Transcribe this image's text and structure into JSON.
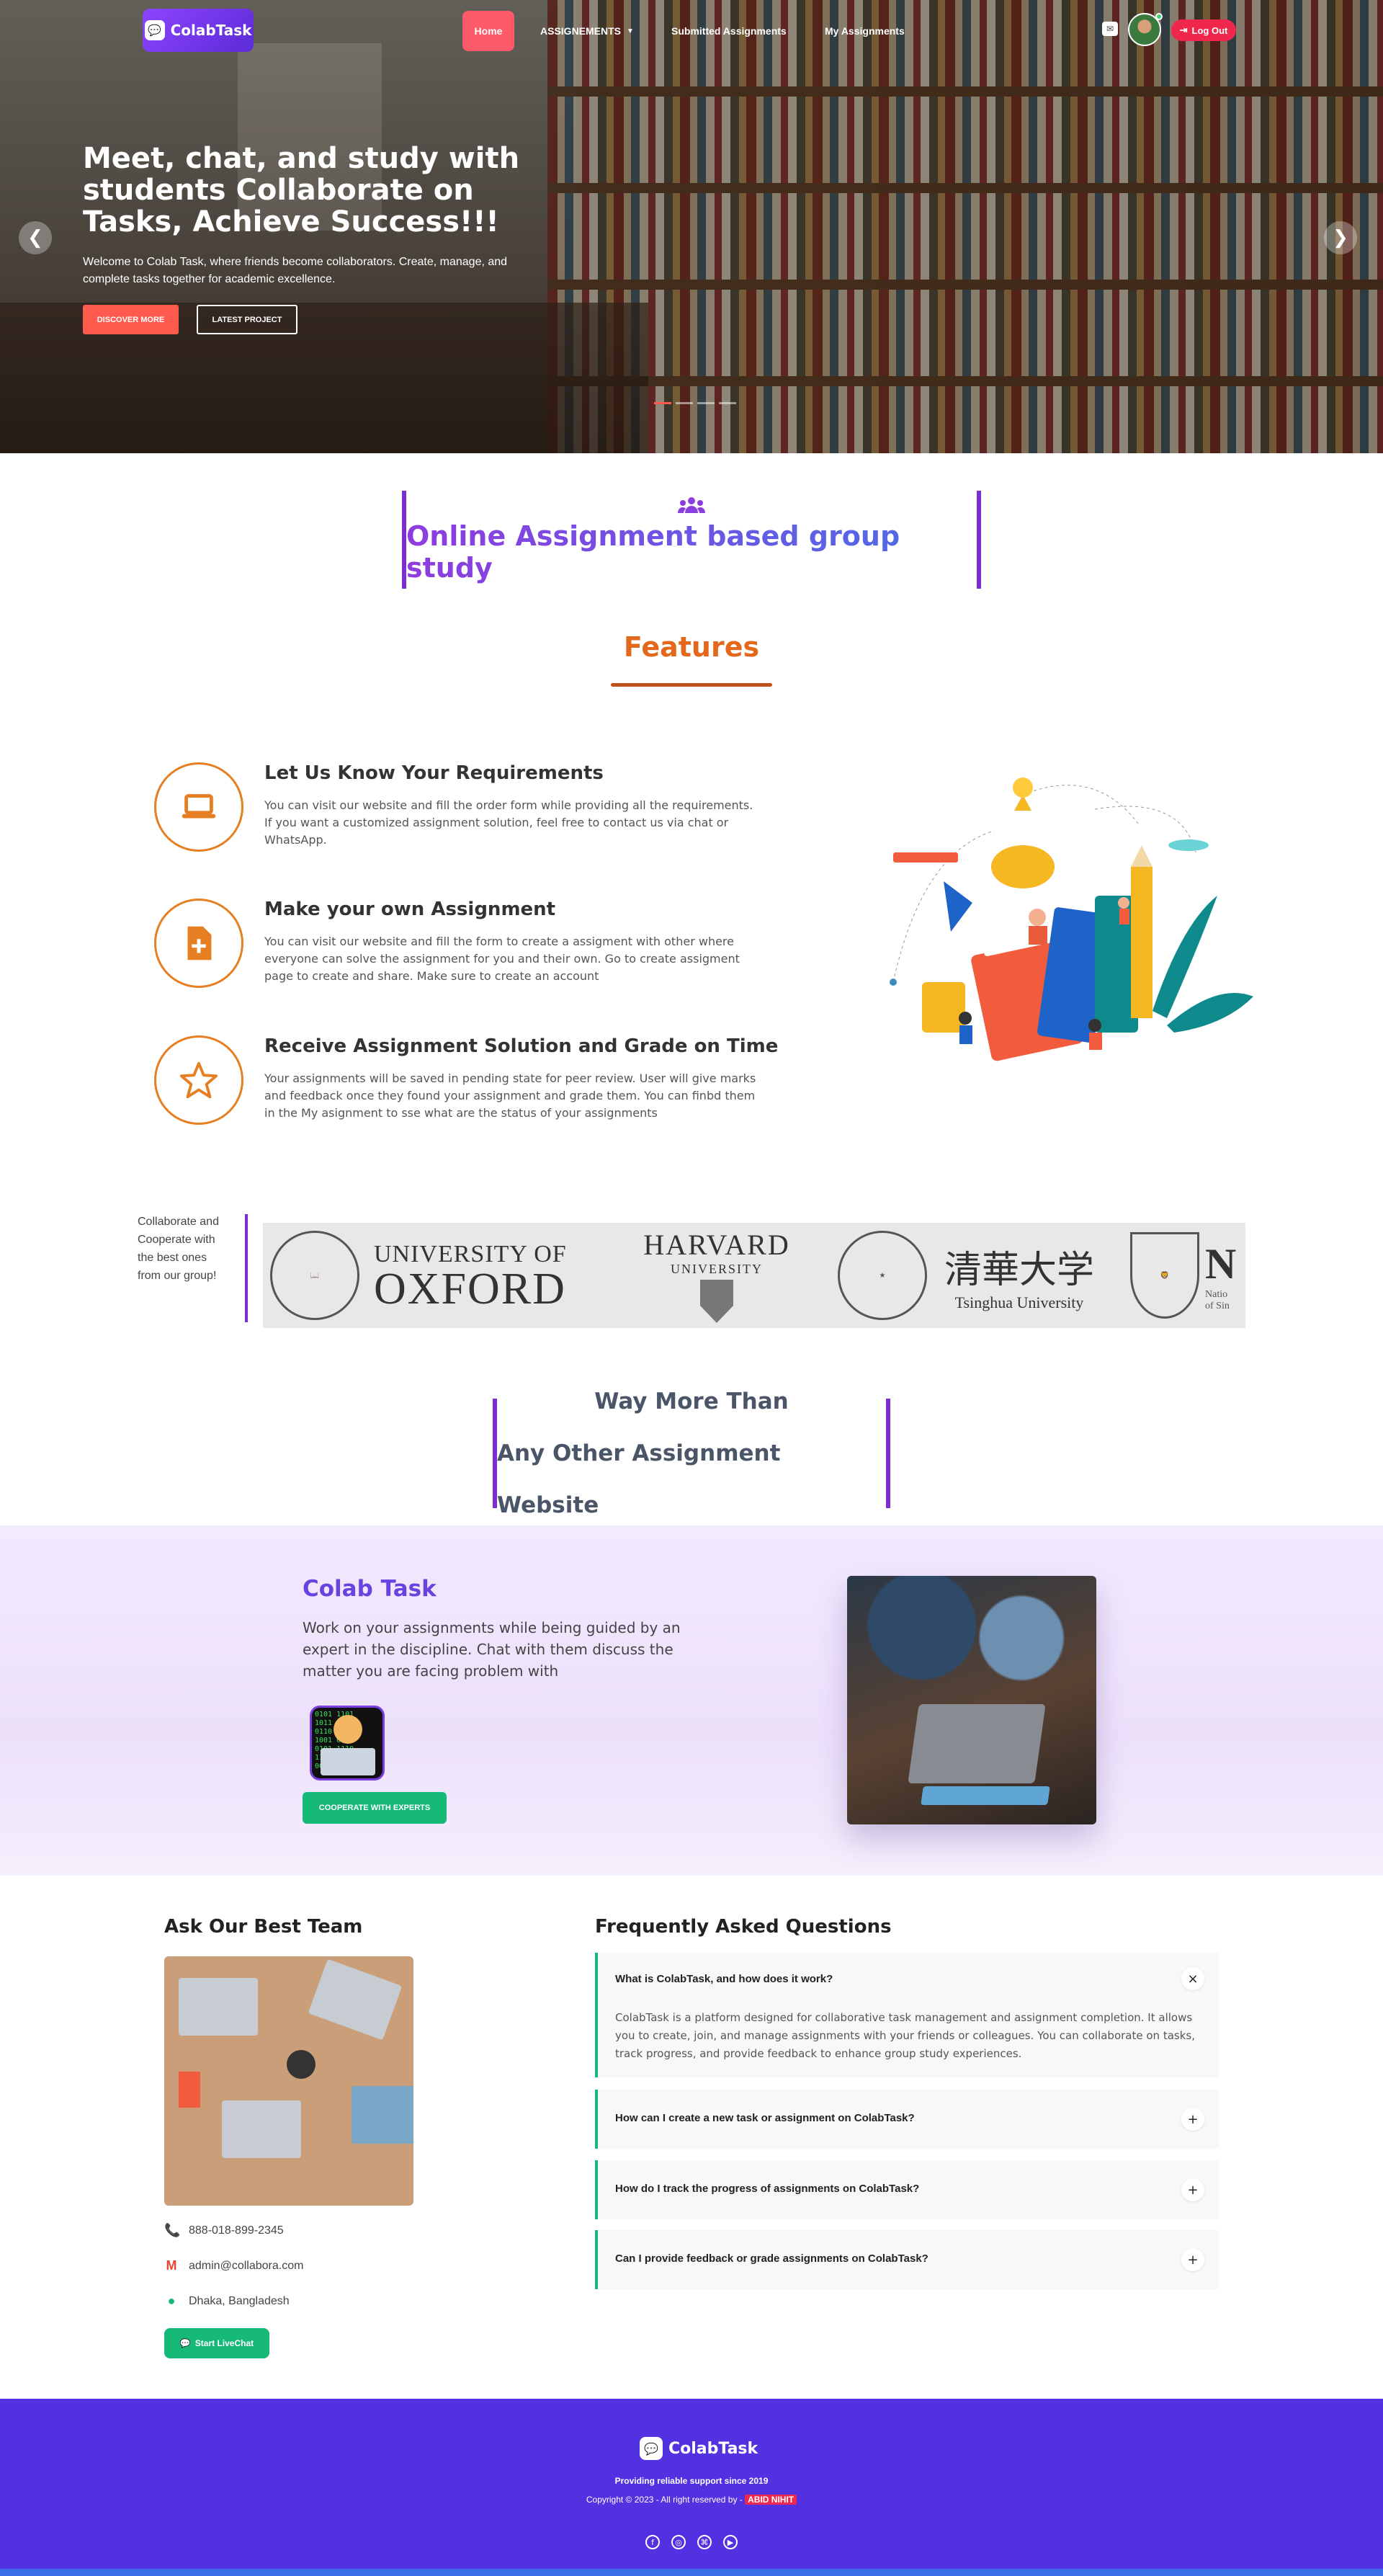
{
  "nav": {
    "logo": "ColabTask",
    "home": "Home",
    "assignments": "ASSIGNEMENTS",
    "submitted": "Submitted Assignments",
    "my": "My Assignments",
    "logout": "Log Out"
  },
  "hero": {
    "title": "Meet, chat, and study with students Collaborate on Tasks, Achieve Success!!!",
    "subtitle": "Welcome to Colab Task, where friends become collaborators. Create, manage, and complete tasks together for academic excellence.",
    "discover": "DISCOVER MORE",
    "latest": "LATEST PROJECT",
    "prev": "❮",
    "next": "❯"
  },
  "intro": {
    "title": "Online Assignment based group study"
  },
  "features": {
    "title": "Features",
    "items": [
      {
        "title": "Let Us Know Your Requirements",
        "text": "You can visit our website and fill the order form while providing all the requirements. If you want a customized assignment solution, feel free to contact us via chat or WhatsApp.",
        "icon": "laptop-icon"
      },
      {
        "title": "Make your own Assignment",
        "text": "You can visit our website and fill the form to create a assigment with other where everyone can solve the assignment for you and their own. Go to create assigment page to create and share. Make sure to create an account",
        "icon": "file-plus-icon"
      },
      {
        "title": "Receive Assignment Solution and Grade on Time",
        "text": "Your assignments will be saved in pending state for peer review. User will give marks and feedback once they found your assignment and grade them. You can finbd them in the My asignment to sse what are the status of your assignments",
        "icon": "star-icon"
      }
    ]
  },
  "partners": {
    "text": "Collaborate and Cooperate with the best ones from our group!",
    "oxford_small": "UNIVERSITY OF",
    "oxford_big": "OXFORD",
    "harvard": "HARVARD",
    "harvard_sub": "UNIVERSITY",
    "tsinghua_cn": "清華大学",
    "tsinghua_en": "Tsinghua University",
    "next_partial": "N",
    "next_partial_sub": "Natio",
    "next_partial_sub2": "of Sin"
  },
  "waymore": {
    "line1": "Way More Than",
    "line2": "Any Other Assignment Website"
  },
  "colab": {
    "title": "Colab Task",
    "text": "Work on your assignments while being guided by an expert in the discipline. Chat with them discuss the matter you are facing problem with",
    "button": "COOPERATE WITH EXPERTS"
  },
  "team": {
    "title": "Ask Our Best Team",
    "phone": "888-018-899-2345",
    "email": "admin@collabora.com",
    "location": "Dhaka, Bangladesh",
    "live": "Start LiveChat"
  },
  "faq": {
    "title": "Frequently Asked Questions",
    "items": [
      {
        "q": "What is ColabTask, and how does it work?",
        "a": "ColabTask is a platform designed for collaborative task management and assignment completion. It allows you to create, join, and manage assignments with your friends or colleagues. You can collaborate on tasks, track progress, and provide feedback to enhance group study experiences.",
        "toggle": "×"
      },
      {
        "q": "How can I create a new task or assignment on ColabTask?",
        "toggle": "+"
      },
      {
        "q": "How do I track the progress of assignments on ColabTask?",
        "toggle": "+"
      },
      {
        "q": "Can I provide feedback or grade assignments on ColabTask?",
        "toggle": "+"
      }
    ]
  },
  "footer": {
    "logo": "ColabTask",
    "tagline": "Providing reliable support since 2019",
    "copy": "Copyright © 2023 - All right reserved by -",
    "name": "ABID NIHIT"
  }
}
